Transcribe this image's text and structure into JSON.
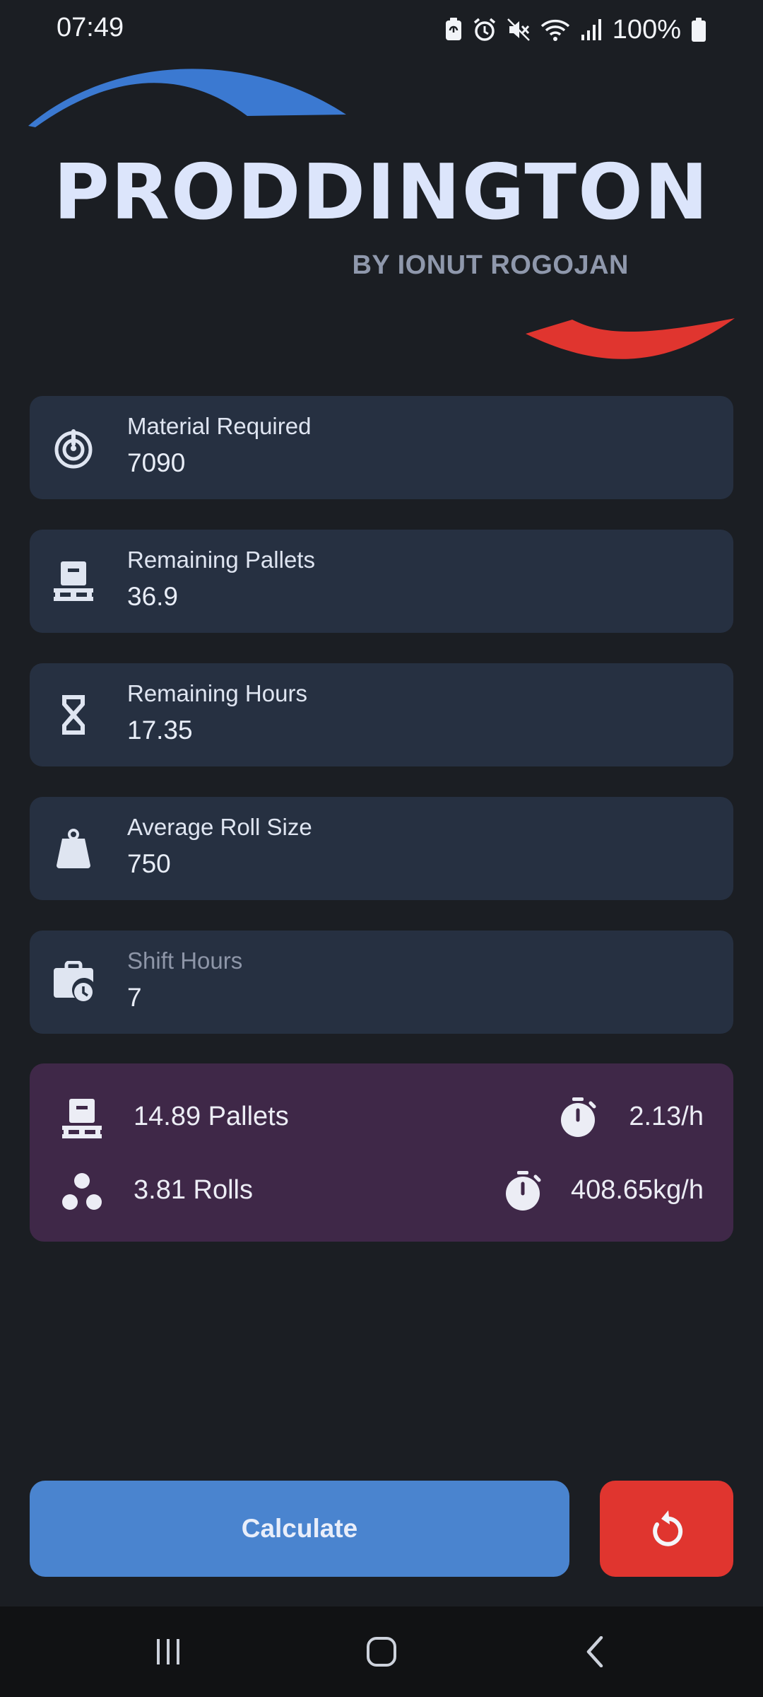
{
  "status_bar": {
    "time": "07:49",
    "battery": "100%",
    "icons": [
      "battery-saver-icon",
      "alarm-icon",
      "mute-icon",
      "wifi-icon",
      "signal-icon",
      "battery-icon"
    ]
  },
  "app": {
    "title": "PRODDINGTON",
    "subtitle": "BY IONUT ROGOJAN"
  },
  "colors": {
    "background": "#1b1e23",
    "card": "#263041",
    "results_card": "#3f2848",
    "accent_blue": "#4a84cf",
    "accent_red": "#e0352f"
  },
  "fields": [
    {
      "icon": "target-icon",
      "label": "Material Required",
      "value": "7090"
    },
    {
      "icon": "pallet-icon",
      "label": "Remaining Pallets",
      "value": "36.9"
    },
    {
      "icon": "hourglass-icon",
      "label": "Remaining Hours",
      "value": "17.35"
    },
    {
      "icon": "weight-icon",
      "label": "Average Roll Size",
      "value": "750"
    },
    {
      "icon": "work-history-icon",
      "label": "Shift Hours",
      "value": "7"
    }
  ],
  "results": {
    "pallets": "14.89 Pallets",
    "pallets_rate": "2.13/h",
    "rolls": "3.81 Rolls",
    "weight_rate": "408.65kg/h"
  },
  "actions": {
    "calculate_label": "Calculate",
    "reset_icon": "reset-icon"
  },
  "nav": {
    "icons": [
      "recents-icon",
      "home-icon",
      "back-icon"
    ]
  }
}
